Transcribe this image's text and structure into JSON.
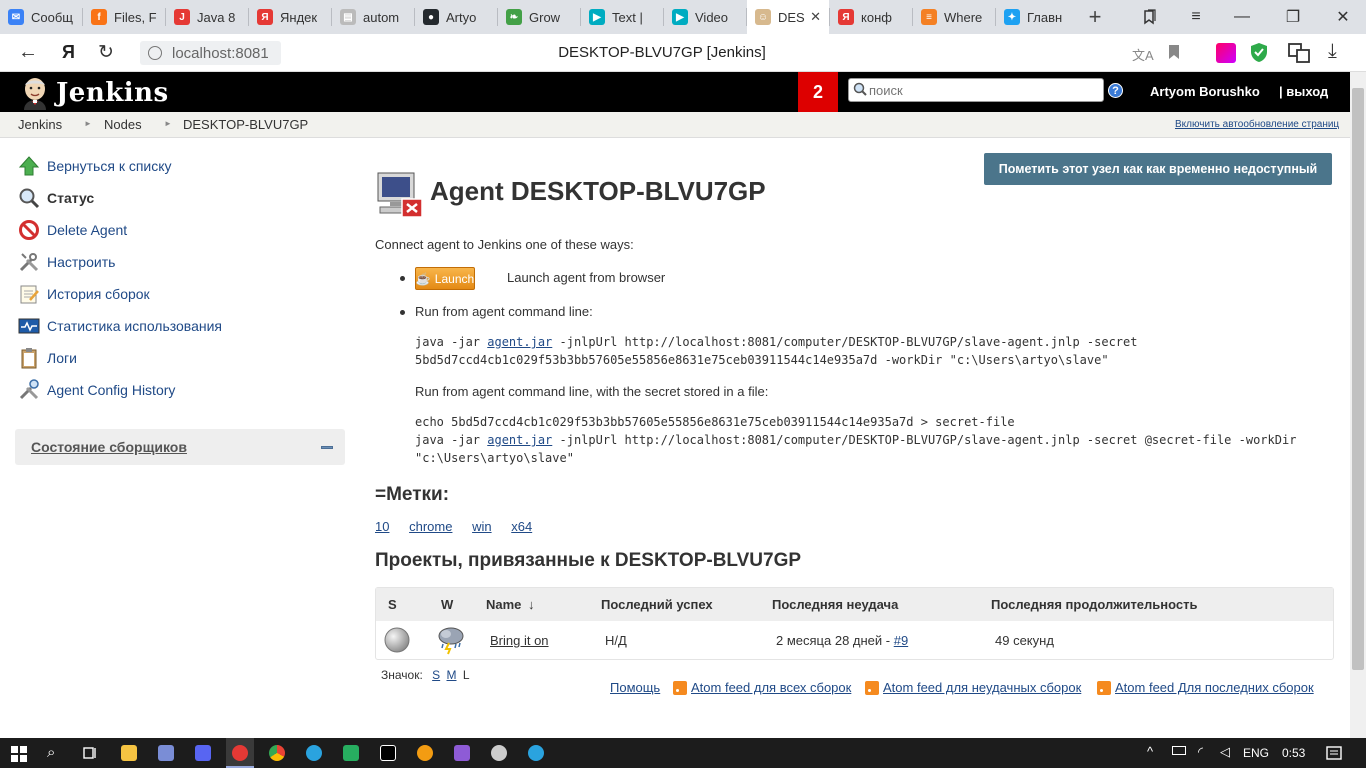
{
  "browser": {
    "tabs": [
      {
        "title": "Сообщ",
        "color": "#3b82f6",
        "glyph": "✉"
      },
      {
        "title": "Files, F",
        "color": "#f97316",
        "glyph": "f"
      },
      {
        "title": "Java 8",
        "color": "#e53935",
        "glyph": "J"
      },
      {
        "title": "Яндек",
        "color": "#e53935",
        "glyph": "Я"
      },
      {
        "title": "autom",
        "color": "#bbbbbb",
        "glyph": "▤"
      },
      {
        "title": "Artyo",
        "color": "#24292e",
        "glyph": "●"
      },
      {
        "title": "Grow",
        "color": "#43a047",
        "glyph": "❧"
      },
      {
        "title": "Text |",
        "color": "#00acc1",
        "glyph": "▶"
      },
      {
        "title": "Video",
        "color": "#00acc1",
        "glyph": "▶"
      },
      {
        "title": "DES",
        "color": "#d7b98e",
        "glyph": "☺"
      },
      {
        "title": "конф",
        "color": "#e53935",
        "glyph": "Я"
      },
      {
        "title": "Where",
        "color": "#f48024",
        "glyph": "≡"
      },
      {
        "title": "Главн",
        "color": "#1da1f2",
        "glyph": "✦"
      }
    ],
    "active_tab_close": "✕",
    "new_tab": "+",
    "url": "localhost:8081",
    "page_title": "DESKTOP-BLVU7GP [Jenkins]",
    "yandex_glyph": "Я"
  },
  "header": {
    "logo_text": "Jenkins",
    "notification_count": "2",
    "search_placeholder": "поиск",
    "help_glyph": "?",
    "user": "Artyom Borushko",
    "logout": "| выход"
  },
  "breadcrumb": {
    "items": [
      "Jenkins",
      "Nodes",
      "DESKTOP-BLVU7GP"
    ],
    "sep": "►",
    "auto_refresh": "Включить автообновление страниц"
  },
  "sidebar": {
    "items": [
      {
        "label": "Вернуться к списку",
        "icon": "up-arrow-icon"
      },
      {
        "label": "Статус",
        "icon": "search-icon"
      },
      {
        "label": "Delete Agent",
        "icon": "no-entry-icon"
      },
      {
        "label": "Настроить",
        "icon": "tools-icon"
      },
      {
        "label": "История сборок",
        "icon": "notepad-icon"
      },
      {
        "label": "Статистика использования",
        "icon": "monitor-chart-icon"
      },
      {
        "label": "Логи",
        "icon": "clipboard-icon"
      },
      {
        "label": "Agent Config History",
        "icon": "config-history-icon"
      }
    ],
    "executors_label": "Состояние сборщиков"
  },
  "main": {
    "mark_offline_button": "Пометить этот узел как как временно недоступный",
    "title": "Agent DESKTOP-BLVU7GP",
    "connect_intro": "Connect agent to Jenkins one of these ways:",
    "launch_button": "Launch",
    "launch_text": "Launch agent from browser",
    "cmdline_label": "Run from agent command line:",
    "cmd1_prefix": "java -jar ",
    "cmd_jar_link": "agent.jar",
    "cmd1_rest": " -jnlpUrl http://localhost:8081/computer/DESKTOP-BLVU7GP/slave-agent.jnlp -secret",
    "cmd1_line2": "5bd5d7ccd4cb1c029f53b3bb57605e55856e8631e75ceb03911544c14e935a7d -workDir \"c:\\Users\\artyo\\slave\"",
    "cmdline_file_label": "Run from agent command line, with the secret stored in a file:",
    "cmd2_line1": "echo 5bd5d7ccd4cb1c029f53b3bb57605e55856e8631e75ceb03911544c14e935a7d > secret-file",
    "cmd2_prefix": "java -jar ",
    "cmd2_rest": " -jnlpUrl http://localhost:8081/computer/DESKTOP-BLVU7GP/slave-agent.jnlp -secret @secret-file -workDir",
    "cmd2_line3": "\"c:\\Users\\artyo\\slave\"",
    "labels_heading": "=Метки:",
    "labels": [
      "10",
      "chrome",
      "win",
      "x64"
    ],
    "projects_heading": "Проекты, привязанные к DESKTOP-BLVU7GP",
    "table": {
      "headers": [
        "S",
        "W",
        "Name",
        "↓",
        "Последний успех",
        "Последняя неудача",
        "Последняя продолжительность"
      ],
      "rows": [
        {
          "name": "Bring it on",
          "last_success": "Н/Д",
          "last_failure": "2 месяца 28 дней - ",
          "failure_build": "#9",
          "duration": "49 секунд"
        }
      ]
    },
    "icon_size_label": "Значок:",
    "icon_sizes": [
      "S",
      "M",
      "L"
    ],
    "footer_links": [
      "Помощь",
      "Atom feed для всех сборок",
      "Atom feed для неудачных сборок",
      "Atom feed Для последних сборок"
    ]
  },
  "taskbar": {
    "lang": "ENG",
    "time": "0:53"
  }
}
